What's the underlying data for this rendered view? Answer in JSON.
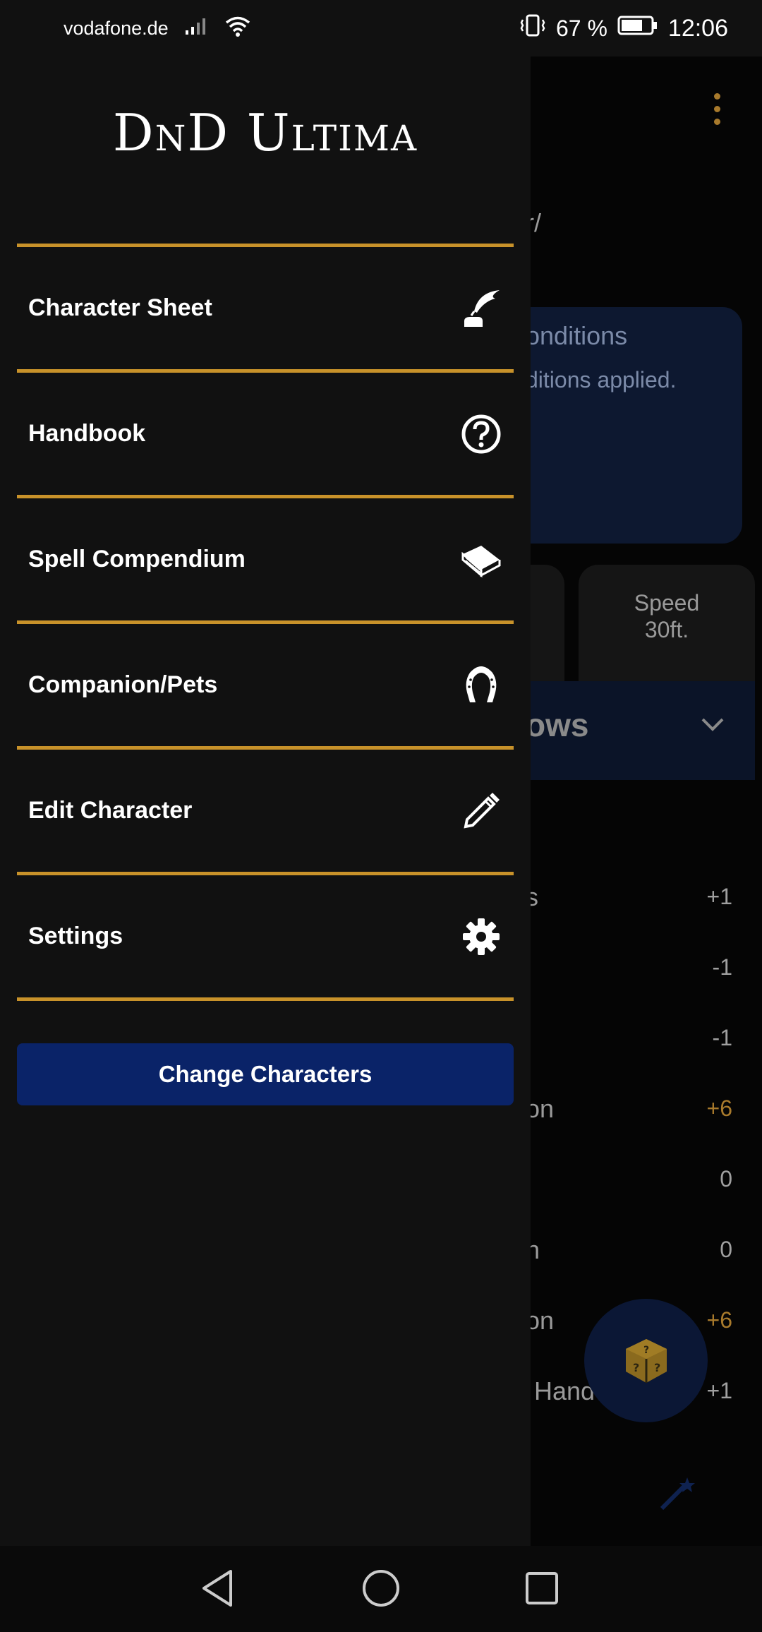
{
  "status_bar": {
    "carrier": "vodafone.de",
    "battery": "67 %",
    "time": "12:06"
  },
  "background": {
    "breadcrumb_fragment": "r/",
    "conditions_title": "onditions",
    "conditions_text": "ditions applied.",
    "speed_label": "Speed",
    "speed_value": "30ft.",
    "throws_fragment": "ows",
    "rows": [
      {
        "label": "s",
        "value": "+1",
        "gold": false
      },
      {
        "label": "",
        "value": "-1",
        "gold": false
      },
      {
        "label": "",
        "value": "-1",
        "gold": false
      },
      {
        "label": "on",
        "value": "+6",
        "gold": true
      },
      {
        "label": "",
        "value": "0",
        "gold": false
      },
      {
        "label": "n",
        "value": "0",
        "gold": false
      },
      {
        "label": "on",
        "value": "+6",
        "gold": true
      },
      {
        "label": "Hand",
        "value": "+1",
        "gold": false
      }
    ]
  },
  "drawer": {
    "title": "DnD Ultima",
    "items": [
      {
        "label": "Character Sheet",
        "icon": "quill-icon"
      },
      {
        "label": "Handbook",
        "icon": "help-circle-icon"
      },
      {
        "label": "Spell Compendium",
        "icon": "book-icon"
      },
      {
        "label": "Companion/Pets",
        "icon": "horseshoe-icon"
      },
      {
        "label": "Edit Character",
        "icon": "pencil-icon"
      },
      {
        "label": "Settings",
        "icon": "gear-icon"
      }
    ],
    "change_button": "Change Characters"
  },
  "colors": {
    "accent_gold": "#c8922a",
    "button_blue": "#0a2368",
    "drawer_bg": "#111111"
  }
}
